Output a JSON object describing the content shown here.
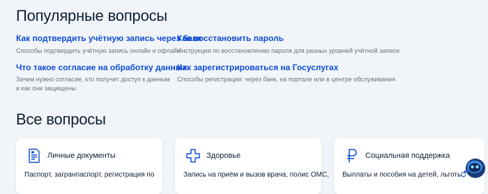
{
  "popular": {
    "heading": "Популярные вопросы",
    "items": [
      {
        "title": "Как подтвердить учётную запись через банк",
        "desc": "Способы подтвердить учётную запись онлайн и офлайн"
      },
      {
        "title": "Как восстановить пароль",
        "desc": "Инструкция по восстановлению пароля для разных уровней учётной записи"
      },
      {
        "title": "Что такое согласие на обработку данных",
        "desc": "Зачем нужно согласие, кто получит доступ к данным и как они защищены"
      },
      {
        "title": "Как зарегистрироваться на Госуслугах",
        "desc": "Способы регистрации: через банк, на портале или в центре обслуживания"
      }
    ]
  },
  "all": {
    "heading": "Все вопросы",
    "cards": [
      {
        "title": "Личные документы",
        "desc": "Паспорт, загранпаспорт, регистрация по",
        "icon": "document-icon"
      },
      {
        "title": "Здоровье",
        "desc": "Запись на приём и вызов врача, полис ОМС,",
        "icon": "medical-cross-icon"
      },
      {
        "title": "Социальная поддержка",
        "desc": "Выплаты и пособия на детей, льготы,",
        "icon": "ruble-icon"
      }
    ]
  },
  "colors": {
    "link": "#0d4cd3",
    "icon": "#0d4cd3",
    "muted": "#66727f",
    "background": "#f1f5f9"
  },
  "assistant": {
    "icon": "robot-assistant-icon"
  }
}
